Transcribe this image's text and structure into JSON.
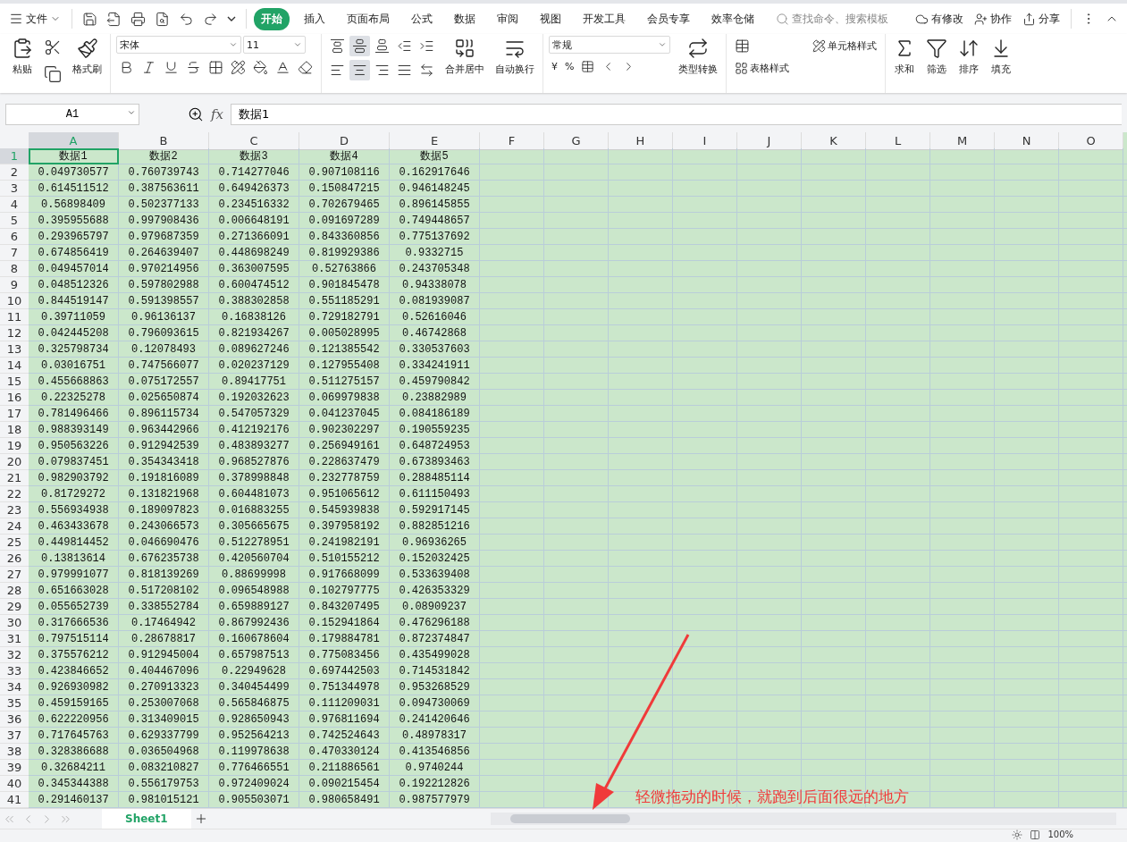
{
  "menu": {
    "file": "文件",
    "tabs": [
      {
        "label": "开始",
        "selected": true
      },
      {
        "label": "插入",
        "selected": false
      },
      {
        "label": "页面布局",
        "selected": false
      },
      {
        "label": "公式",
        "selected": false
      },
      {
        "label": "数据",
        "selected": false
      },
      {
        "label": "审阅",
        "selected": false
      },
      {
        "label": "视图",
        "selected": false
      },
      {
        "label": "开发工具",
        "selected": false
      },
      {
        "label": "会员专享",
        "selected": false
      },
      {
        "label": "效率仓储",
        "selected": false
      }
    ],
    "search": {
      "placeholder": "查找命令、搜索模板"
    },
    "actions": [
      "有修改",
      "协作",
      "分享"
    ]
  },
  "ribbon": {
    "paste": "粘贴",
    "format_painter": "格式刷",
    "font": "宋体",
    "font_size": "11",
    "merge": "合并居中",
    "wrap": "自动换行",
    "number_format": "常规",
    "currency": "¥",
    "percent": "%",
    "convert": "类型转换",
    "table_style": "表格样式",
    "cell_style": "单元格样式",
    "sum": "求和",
    "filter": "筛选",
    "sort": "排序",
    "fill": "填充",
    "vertical_align": [
      {
        "selected": false
      },
      {
        "selected": true
      },
      {
        "selected": false
      }
    ],
    "horizontal_align": [
      {
        "selected": false
      },
      {
        "selected": true
      },
      {
        "selected": false
      },
      {
        "selected": false
      }
    ]
  },
  "formula_bar": {
    "name_box": "A1",
    "fx": "fx",
    "value": "数据1"
  },
  "table": {
    "columns": [
      {
        "label": "A",
        "selected": true
      },
      {
        "label": "B",
        "selected": false
      },
      {
        "label": "C",
        "selected": false
      },
      {
        "label": "D",
        "selected": false
      },
      {
        "label": "E",
        "selected": false
      },
      {
        "label": "F",
        "selected": false
      },
      {
        "label": "G",
        "selected": false
      },
      {
        "label": "H",
        "selected": false
      },
      {
        "label": "I",
        "selected": false
      },
      {
        "label": "J",
        "selected": false
      },
      {
        "label": "K",
        "selected": false
      },
      {
        "label": "L",
        "selected": false
      },
      {
        "label": "M",
        "selected": false
      },
      {
        "label": "N",
        "selected": false
      },
      {
        "label": "O",
        "selected": false
      }
    ],
    "rows": [
      {
        "number": "1",
        "selected": true,
        "cells": [
          "数据1",
          "数据2",
          "数据3",
          "数据4",
          "数据5"
        ]
      },
      {
        "number": "2",
        "selected": false,
        "cells": [
          "0.049730577",
          "0.760739743",
          "0.714277046",
          "0.907108116",
          "0.162917646"
        ]
      },
      {
        "number": "3",
        "selected": false,
        "cells": [
          "0.614511512",
          "0.387563611",
          "0.649426373",
          "0.150847215",
          "0.946148245"
        ]
      },
      {
        "number": "4",
        "selected": false,
        "cells": [
          "0.56898409",
          "0.502377133",
          "0.234516332",
          "0.702679465",
          "0.896145855"
        ]
      },
      {
        "number": "5",
        "selected": false,
        "cells": [
          "0.395955688",
          "0.997908436",
          "0.006648191",
          "0.091697289",
          "0.749448657"
        ]
      },
      {
        "number": "6",
        "selected": false,
        "cells": [
          "0.293965797",
          "0.979687359",
          "0.271366091",
          "0.843360856",
          "0.775137692"
        ]
      },
      {
        "number": "7",
        "selected": false,
        "cells": [
          "0.674856419",
          "0.264639407",
          "0.448698249",
          "0.819929386",
          "0.9332715"
        ]
      },
      {
        "number": "8",
        "selected": false,
        "cells": [
          "0.049457014",
          "0.970214956",
          "0.363007595",
          "0.52763866",
          "0.243705348"
        ]
      },
      {
        "number": "9",
        "selected": false,
        "cells": [
          "0.048512326",
          "0.597802988",
          "0.600474512",
          "0.901845478",
          "0.94338078"
        ]
      },
      {
        "number": "10",
        "selected": false,
        "cells": [
          "0.844519147",
          "0.591398557",
          "0.388302858",
          "0.551185291",
          "0.081939087"
        ]
      },
      {
        "number": "11",
        "selected": false,
        "cells": [
          "0.39711059",
          "0.96136137",
          "0.16838126",
          "0.729182791",
          "0.52616046"
        ]
      },
      {
        "number": "12",
        "selected": false,
        "cells": [
          "0.042445208",
          "0.796093615",
          "0.821934267",
          "0.005028995",
          "0.46742868"
        ]
      },
      {
        "number": "13",
        "selected": false,
        "cells": [
          "0.325798734",
          "0.12078493",
          "0.089627246",
          "0.121385542",
          "0.330537603"
        ]
      },
      {
        "number": "14",
        "selected": false,
        "cells": [
          "0.03016751",
          "0.747566077",
          "0.020237129",
          "0.127955408",
          "0.334241911"
        ]
      },
      {
        "number": "15",
        "selected": false,
        "cells": [
          "0.455668863",
          "0.075172557",
          "0.89417751",
          "0.511275157",
          "0.459790842"
        ]
      },
      {
        "number": "16",
        "selected": false,
        "cells": [
          "0.22325278",
          "0.025650874",
          "0.192032623",
          "0.069979838",
          "0.23882989"
        ]
      },
      {
        "number": "17",
        "selected": false,
        "cells": [
          "0.781496466",
          "0.896115734",
          "0.547057329",
          "0.041237045",
          "0.084186189"
        ]
      },
      {
        "number": "18",
        "selected": false,
        "cells": [
          "0.988393149",
          "0.963442966",
          "0.412192176",
          "0.902302297",
          "0.190559235"
        ]
      },
      {
        "number": "19",
        "selected": false,
        "cells": [
          "0.950563226",
          "0.912942539",
          "0.483893277",
          "0.256949161",
          "0.648724953"
        ]
      },
      {
        "number": "20",
        "selected": false,
        "cells": [
          "0.079837451",
          "0.354343418",
          "0.968527876",
          "0.228637479",
          "0.673893463"
        ]
      },
      {
        "number": "21",
        "selected": false,
        "cells": [
          "0.982903792",
          "0.191816089",
          "0.378998848",
          "0.232778759",
          "0.288485114"
        ]
      },
      {
        "number": "22",
        "selected": false,
        "cells": [
          "0.81729272",
          "0.131821968",
          "0.604481073",
          "0.951065612",
          "0.611150493"
        ]
      },
      {
        "number": "23",
        "selected": false,
        "cells": [
          "0.556934938",
          "0.189097823",
          "0.016883255",
          "0.545939838",
          "0.592917145"
        ]
      },
      {
        "number": "24",
        "selected": false,
        "cells": [
          "0.463433678",
          "0.243066573",
          "0.305665675",
          "0.397958192",
          "0.882851216"
        ]
      },
      {
        "number": "25",
        "selected": false,
        "cells": [
          "0.449814452",
          "0.046690476",
          "0.512278951",
          "0.241982191",
          "0.96936265"
        ]
      },
      {
        "number": "26",
        "selected": false,
        "cells": [
          "0.13813614",
          "0.676235738",
          "0.420560704",
          "0.510155212",
          "0.152032425"
        ]
      },
      {
        "number": "27",
        "selected": false,
        "cells": [
          "0.979991077",
          "0.818139269",
          "0.88699998",
          "0.917668099",
          "0.533639408"
        ]
      },
      {
        "number": "28",
        "selected": false,
        "cells": [
          "0.651663028",
          "0.517208102",
          "0.096548988",
          "0.102797775",
          "0.426353329"
        ]
      },
      {
        "number": "29",
        "selected": false,
        "cells": [
          "0.055652739",
          "0.338552784",
          "0.659889127",
          "0.843207495",
          "0.08909237"
        ]
      },
      {
        "number": "30",
        "selected": false,
        "cells": [
          "0.317666536",
          "0.17464942",
          "0.867992436",
          "0.152941864",
          "0.476296188"
        ]
      },
      {
        "number": "31",
        "selected": false,
        "cells": [
          "0.797515114",
          "0.28678817",
          "0.160678604",
          "0.179884781",
          "0.872374847"
        ]
      },
      {
        "number": "32",
        "selected": false,
        "cells": [
          "0.375576212",
          "0.912945004",
          "0.657987513",
          "0.775083456",
          "0.435499028"
        ]
      },
      {
        "number": "33",
        "selected": false,
        "cells": [
          "0.423846652",
          "0.404467096",
          "0.22949628",
          "0.697442503",
          "0.714531842"
        ]
      },
      {
        "number": "34",
        "selected": false,
        "cells": [
          "0.926930982",
          "0.270913323",
          "0.340454499",
          "0.751344978",
          "0.953268529"
        ]
      },
      {
        "number": "35",
        "selected": false,
        "cells": [
          "0.459159165",
          "0.253007068",
          "0.565846875",
          "0.111209031",
          "0.094730069"
        ]
      },
      {
        "number": "36",
        "selected": false,
        "cells": [
          "0.622220956",
          "0.313409015",
          "0.928650943",
          "0.976811694",
          "0.241420646"
        ]
      },
      {
        "number": "37",
        "selected": false,
        "cells": [
          "0.717645763",
          "0.629337799",
          "0.952564213",
          "0.742524643",
          "0.48978317"
        ]
      },
      {
        "number": "38",
        "selected": false,
        "cells": [
          "0.328386688",
          "0.036504968",
          "0.119978638",
          "0.470330124",
          "0.413546856"
        ]
      },
      {
        "number": "39",
        "selected": false,
        "cells": [
          "0.32684211",
          "0.083210827",
          "0.776466551",
          "0.211886561",
          "0.9740244"
        ]
      },
      {
        "number": "40",
        "selected": false,
        "cells": [
          "0.345344388",
          "0.556179753",
          "0.972409024",
          "0.090215454",
          "0.192212826"
        ]
      },
      {
        "number": "41",
        "selected": false,
        "cells": [
          "0.291460137",
          "0.981015121",
          "0.905503071",
          "0.980658491",
          "0.987577979"
        ]
      }
    ]
  },
  "sheet_tabs": [
    {
      "label": "Sheet1",
      "selected": true
    }
  ],
  "annotation": "轻微拖动的时候，就跑到后面很远的地方",
  "status_bar": {
    "zoom": "100%"
  }
}
